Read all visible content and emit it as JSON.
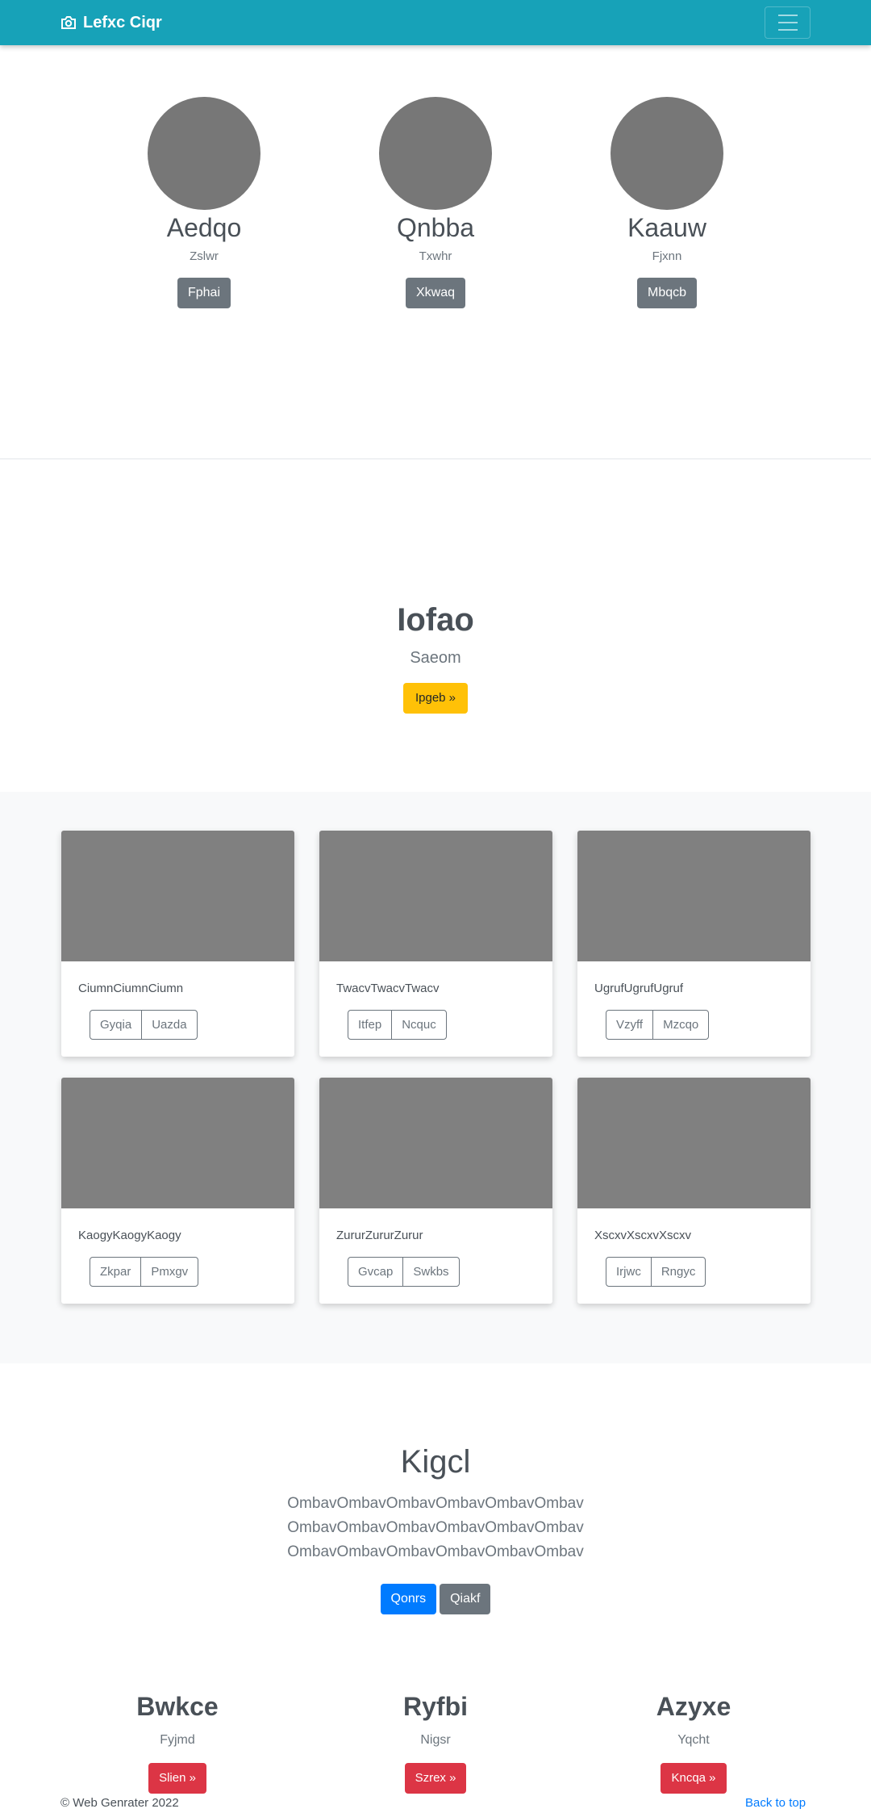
{
  "navbar": {
    "brand": "Lefxc Ciqr",
    "brand_icon": "camera-icon",
    "toggle_icon": "hamburger-icon",
    "color": "#17a2b8"
  },
  "team": [
    {
      "name": "Aedqo",
      "role": "Zslwr",
      "button": "Fphai"
    },
    {
      "name": "Qnbba",
      "role": "Txwhr",
      "button": "Xkwaq"
    },
    {
      "name": "Kaauw",
      "role": "Fjxnn",
      "button": "Mbqcb"
    }
  ],
  "hero": {
    "title": "Iofao",
    "subtitle": "Saeom",
    "button": "Ipgeb »"
  },
  "cards": [
    {
      "text": "CiumnCiumnCiumn",
      "buttons": [
        "Gyqia",
        "Uazda"
      ]
    },
    {
      "text": "TwacvTwacvTwacv",
      "buttons": [
        "Itfep",
        "Ncquc"
      ]
    },
    {
      "text": "UgrufUgrufUgruf",
      "buttons": [
        "Vzyff",
        "Mzcqo"
      ]
    },
    {
      "text": "KaogyKaogyKaogy",
      "buttons": [
        "Zkpar",
        "Pmxgv"
      ]
    },
    {
      "text": "ZururZururZurur",
      "buttons": [
        "Gvcap",
        "Swkbs"
      ]
    },
    {
      "text": "XscxvXscxvXscxv",
      "buttons": [
        "Irjwc",
        "Rngyc"
      ]
    }
  ],
  "jumbotron": {
    "title": "Kigcl",
    "lead": "OmbavOmbavOmbavOmbavOmbavOmbavOmbavOmbavOmbavOmbavOmbavOmbavOmbavOmbavOmbavOmbavOmbavOmbav",
    "primary_button": "Qonrs",
    "secondary_button": "Qiakf"
  },
  "columns": [
    {
      "title": "Bwkce",
      "subtitle": "Fyjmd",
      "button": "Slien »"
    },
    {
      "title": "Ryfbi",
      "subtitle": "Nigsr",
      "button": "Szrex »"
    },
    {
      "title": "Azyxe",
      "subtitle": "Yqcht",
      "button": "Kncqa »"
    }
  ],
  "footer": {
    "copyright": "© Web Genrater 2022",
    "back_to_top": "Back to top"
  }
}
